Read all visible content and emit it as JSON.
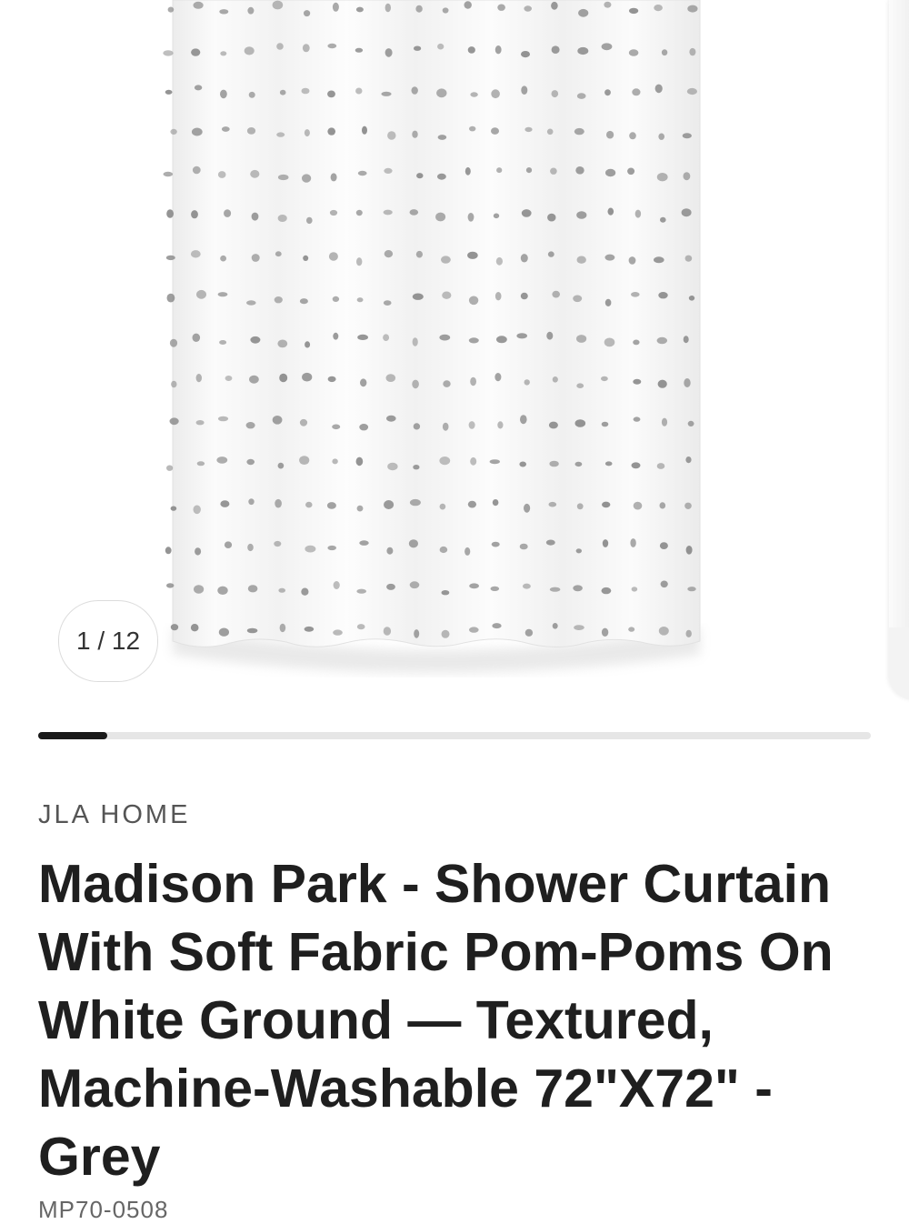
{
  "gallery": {
    "counter": "1 / 12",
    "current_index": 1,
    "total": 12,
    "progress_fraction": 0.083,
    "image_alt": "Madison Park shower curtain with grey pom-poms on white ground"
  },
  "product": {
    "brand": "JLA HOME",
    "title": "Madison Park - Shower Curtain With Soft Fabric Pom-Poms On White Ground — Textured, Machine-Washable 72\"X72\" - Grey",
    "sku": "MP70-0508"
  },
  "colors": {
    "progress_active": "#1a1a1a",
    "progress_track": "#e6e6e6",
    "curtain": "#fafafa",
    "pompom": "#8a8a8a"
  }
}
